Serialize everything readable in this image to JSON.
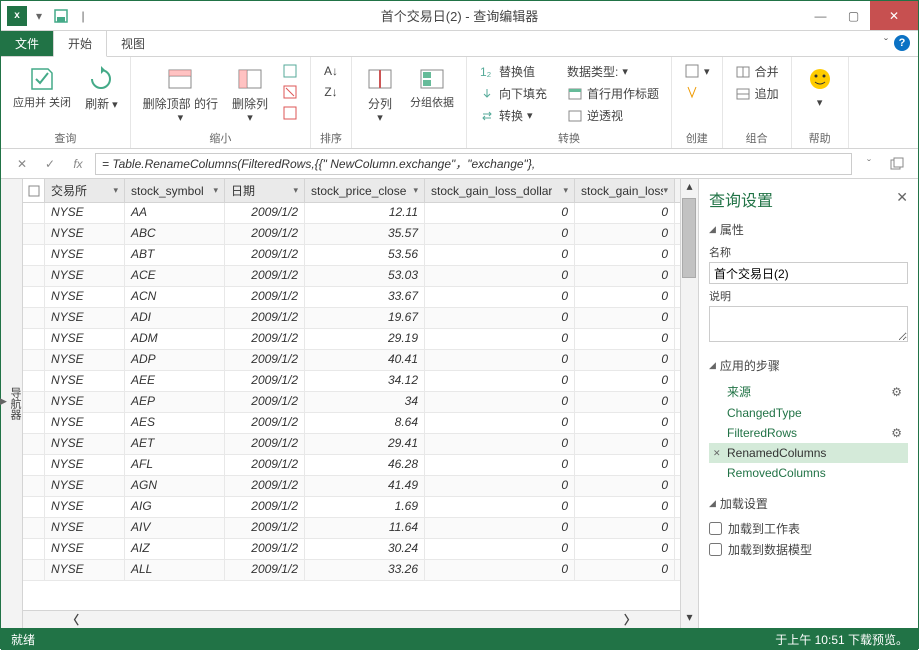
{
  "window": {
    "title": "首个交易日(2) - 查询编辑器"
  },
  "tabs": {
    "file": "文件",
    "home": "开始",
    "view": "视图"
  },
  "ribbon": {
    "query": {
      "label": "查询",
      "applyClose": "应用并\n关闭",
      "refresh": "刷新"
    },
    "reduce": {
      "label": "缩小",
      "removeTop": "删除顶部\n的行",
      "removeCols": "删除列"
    },
    "sort": {
      "label": "排序"
    },
    "split": {
      "label": "",
      "splitCol": "分列",
      "groupBy": "分组依据"
    },
    "transform": {
      "label": "转换",
      "replace": "替换值",
      "fillDown": "向下填充",
      "convert": "转换",
      "dataType": "数据类型:",
      "firstRowHeader": "首行用作标题",
      "unpivot": "逆透视"
    },
    "create": {
      "label": "创建"
    },
    "combine": {
      "label": "组合",
      "merge": "合并",
      "append": "追加"
    },
    "help": {
      "label": "帮助"
    }
  },
  "formula": "= Table.RenameColumns(FilteredRows,{{\" NewColumn.exchange\"，\"exchange\"},",
  "nav": "导航器",
  "columns": [
    "交易所",
    "stock_symbol",
    "日期",
    "stock_price_close",
    "stock_gain_loss_dollar",
    "stock_gain_loss_p"
  ],
  "rows": [
    [
      "NYSE",
      "AA",
      "2009/1/2",
      "12.11",
      "0",
      "0"
    ],
    [
      "NYSE",
      "ABC",
      "2009/1/2",
      "35.57",
      "0",
      "0"
    ],
    [
      "NYSE",
      "ABT",
      "2009/1/2",
      "53.56",
      "0",
      "0"
    ],
    [
      "NYSE",
      "ACE",
      "2009/1/2",
      "53.03",
      "0",
      "0"
    ],
    [
      "NYSE",
      "ACN",
      "2009/1/2",
      "33.67",
      "0",
      "0"
    ],
    [
      "NYSE",
      "ADI",
      "2009/1/2",
      "19.67",
      "0",
      "0"
    ],
    [
      "NYSE",
      "ADM",
      "2009/1/2",
      "29.19",
      "0",
      "0"
    ],
    [
      "NYSE",
      "ADP",
      "2009/1/2",
      "40.41",
      "0",
      "0"
    ],
    [
      "NYSE",
      "AEE",
      "2009/1/2",
      "34.12",
      "0",
      "0"
    ],
    [
      "NYSE",
      "AEP",
      "2009/1/2",
      "34",
      "0",
      "0"
    ],
    [
      "NYSE",
      "AES",
      "2009/1/2",
      "8.64",
      "0",
      "0"
    ],
    [
      "NYSE",
      "AET",
      "2009/1/2",
      "29.41",
      "0",
      "0"
    ],
    [
      "NYSE",
      "AFL",
      "2009/1/2",
      "46.28",
      "0",
      "0"
    ],
    [
      "NYSE",
      "AGN",
      "2009/1/2",
      "41.49",
      "0",
      "0"
    ],
    [
      "NYSE",
      "AIG",
      "2009/1/2",
      "1.69",
      "0",
      "0"
    ],
    [
      "NYSE",
      "AIV",
      "2009/1/2",
      "11.64",
      "0",
      "0"
    ],
    [
      "NYSE",
      "AIZ",
      "2009/1/2",
      "30.24",
      "0",
      "0"
    ],
    [
      "NYSE",
      "ALL",
      "2009/1/2",
      "33.26",
      "0",
      "0"
    ]
  ],
  "querySettings": {
    "title": "查询设置",
    "propsHead": "属性",
    "nameLabel": "名称",
    "nameValue": "首个交易日(2)",
    "descLabel": "说明",
    "stepsHead": "应用的步骤",
    "steps": [
      "来源",
      "ChangedType",
      "FilteredRows",
      "RenamedColumns",
      "RemovedColumns"
    ],
    "selectedStep": 3,
    "loadHead": "加载设置",
    "loadSheet": "加载到工作表",
    "loadModel": "加载到数据模型"
  },
  "status": {
    "left": "就绪",
    "right": "于上午 10:51 下载预览。"
  }
}
